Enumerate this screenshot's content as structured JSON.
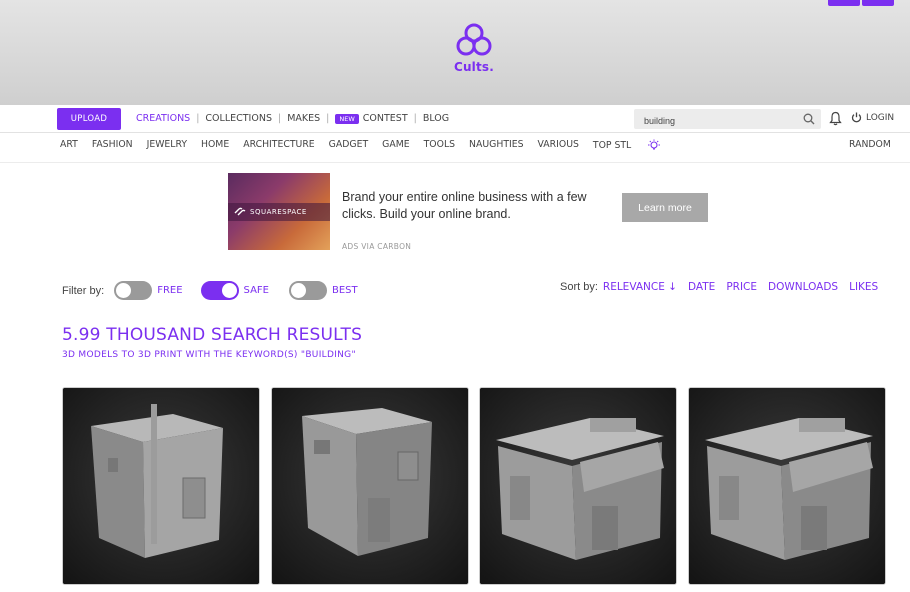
{
  "header": {
    "logo_text": "Cults."
  },
  "mainnav": {
    "upload_label": "UPLOAD",
    "links": [
      "CREATIONS",
      "COLLECTIONS",
      "MAKES",
      "CONTEST",
      "BLOG"
    ],
    "new_badge": "NEW",
    "search_value": "building",
    "login_label": "LOGIN"
  },
  "categories": {
    "items": [
      "ART",
      "FASHION",
      "JEWELRY",
      "HOME",
      "ARCHITECTURE",
      "GADGET",
      "GAME",
      "TOOLS",
      "NAUGHTIES",
      "VARIOUS",
      "TOP STL"
    ],
    "random_label": "RANDOM"
  },
  "ad": {
    "brand": "SQUARESPACE",
    "text": "Brand your entire online business with a few clicks. Build your online brand.",
    "via": "ADS VIA CARBON",
    "button_label": "Learn more"
  },
  "filter": {
    "label": "Filter by:",
    "options": [
      {
        "label": "FREE",
        "on": false
      },
      {
        "label": "SAFE",
        "on": true
      },
      {
        "label": "BEST",
        "on": false
      }
    ]
  },
  "sort": {
    "label": "Sort by:",
    "options": [
      "RELEVANCE ↓",
      "DATE",
      "PRICE",
      "DOWNLOADS",
      "LIKES"
    ]
  },
  "results": {
    "title": "5.99 THOUSAND SEARCH RESULTS",
    "subtitle": "3D MODELS TO 3D PRINT WITH THE KEYWORD(S) \"BUILDING\""
  },
  "colors": {
    "accent": "#7b2ff0",
    "card_bg": "#222222"
  }
}
